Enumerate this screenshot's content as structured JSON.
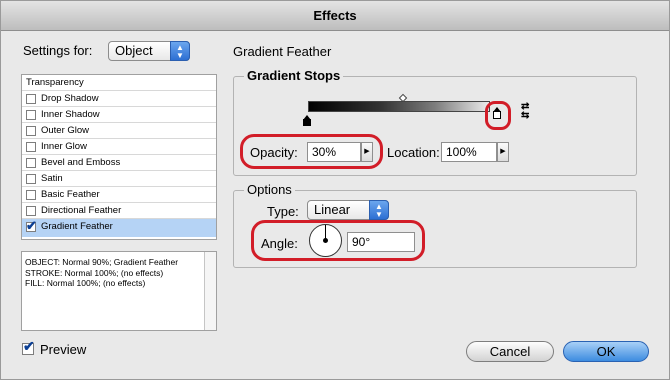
{
  "window": {
    "title": "Effects"
  },
  "settings_for": {
    "label": "Settings for:",
    "value": "Object"
  },
  "effects_list": {
    "header": "Transparency",
    "items": [
      {
        "label": "Drop Shadow",
        "checked": false,
        "selected": false
      },
      {
        "label": "Inner Shadow",
        "checked": false,
        "selected": false
      },
      {
        "label": "Outer Glow",
        "checked": false,
        "selected": false
      },
      {
        "label": "Inner Glow",
        "checked": false,
        "selected": false
      },
      {
        "label": "Bevel and Emboss",
        "checked": false,
        "selected": false
      },
      {
        "label": "Satin",
        "checked": false,
        "selected": false
      },
      {
        "label": "Basic Feather",
        "checked": false,
        "selected": false
      },
      {
        "label": "Directional Feather",
        "checked": false,
        "selected": false
      },
      {
        "label": "Gradient Feather",
        "checked": true,
        "selected": true
      }
    ]
  },
  "summary": {
    "line1": "OBJECT: Normal 90%; Gradient Feather",
    "line2": "STROKE: Normal 100%; (no effects)",
    "line3": "FILL: Normal 100%; (no effects)"
  },
  "panel": {
    "title": "Gradient Feather",
    "gradient_stops": {
      "title": "Gradient Stops",
      "opacity_label": "Opacity:",
      "opacity_value": "30%",
      "location_label": "Location:",
      "location_value": "100%"
    },
    "options": {
      "title": "Options",
      "type_label": "Type:",
      "type_value": "Linear",
      "angle_label": "Angle:",
      "angle_value": "90°"
    }
  },
  "preview": {
    "label": "Preview",
    "checked": true
  },
  "buttons": {
    "cancel": "Cancel",
    "ok": "OK"
  },
  "colors": {
    "highlight_ring": "#d21d28",
    "selection": "#b5d3f5",
    "accent": "#3d8ce0"
  }
}
